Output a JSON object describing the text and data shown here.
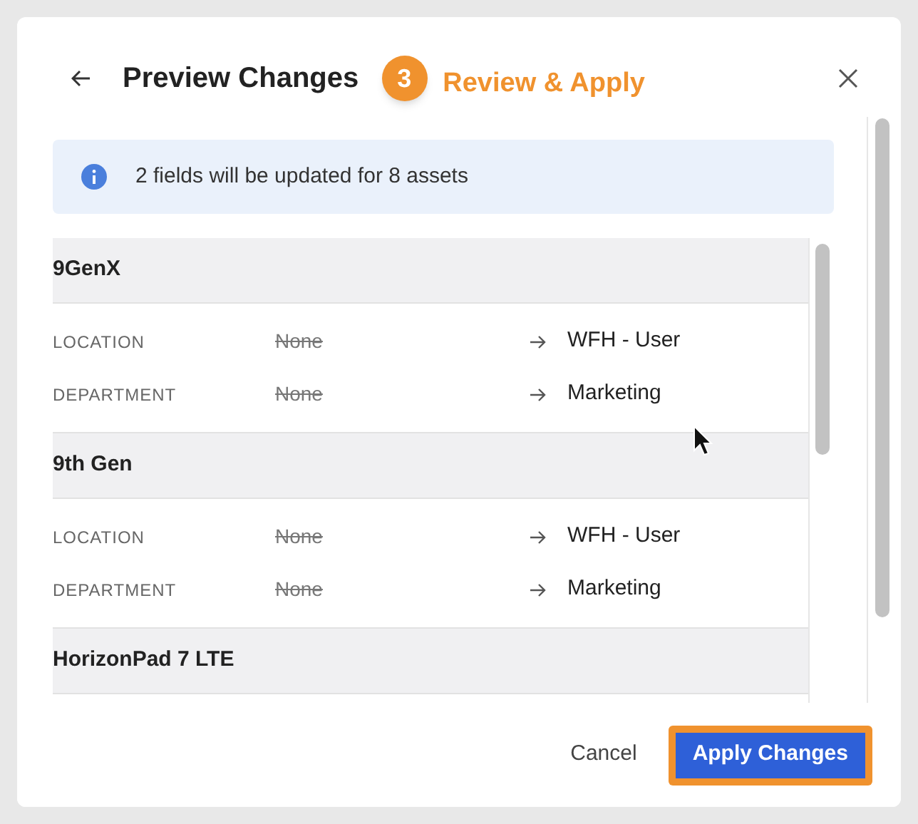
{
  "header": {
    "title": "Preview Changes",
    "step": {
      "number": "3",
      "label": "Review & Apply"
    }
  },
  "banner": {
    "text": "2 fields will be updated for 8 assets"
  },
  "assets": [
    {
      "name": "9GenX",
      "fields": [
        {
          "label": "LOCATION",
          "old": "None",
          "new": "WFH - User"
        },
        {
          "label": "DEPARTMENT",
          "old": "None",
          "new": "Marketing"
        }
      ]
    },
    {
      "name": "9th Gen",
      "fields": [
        {
          "label": "LOCATION",
          "old": "None",
          "new": "WFH - User"
        },
        {
          "label": "DEPARTMENT",
          "old": "None",
          "new": "Marketing"
        }
      ]
    },
    {
      "name": "HorizonPad 7 LTE"
    }
  ],
  "footer": {
    "buttons": [
      {
        "label": "Cancel",
        "kind": "secondary"
      },
      {
        "label": "Apply Changes",
        "kind": "primary"
      }
    ]
  }
}
